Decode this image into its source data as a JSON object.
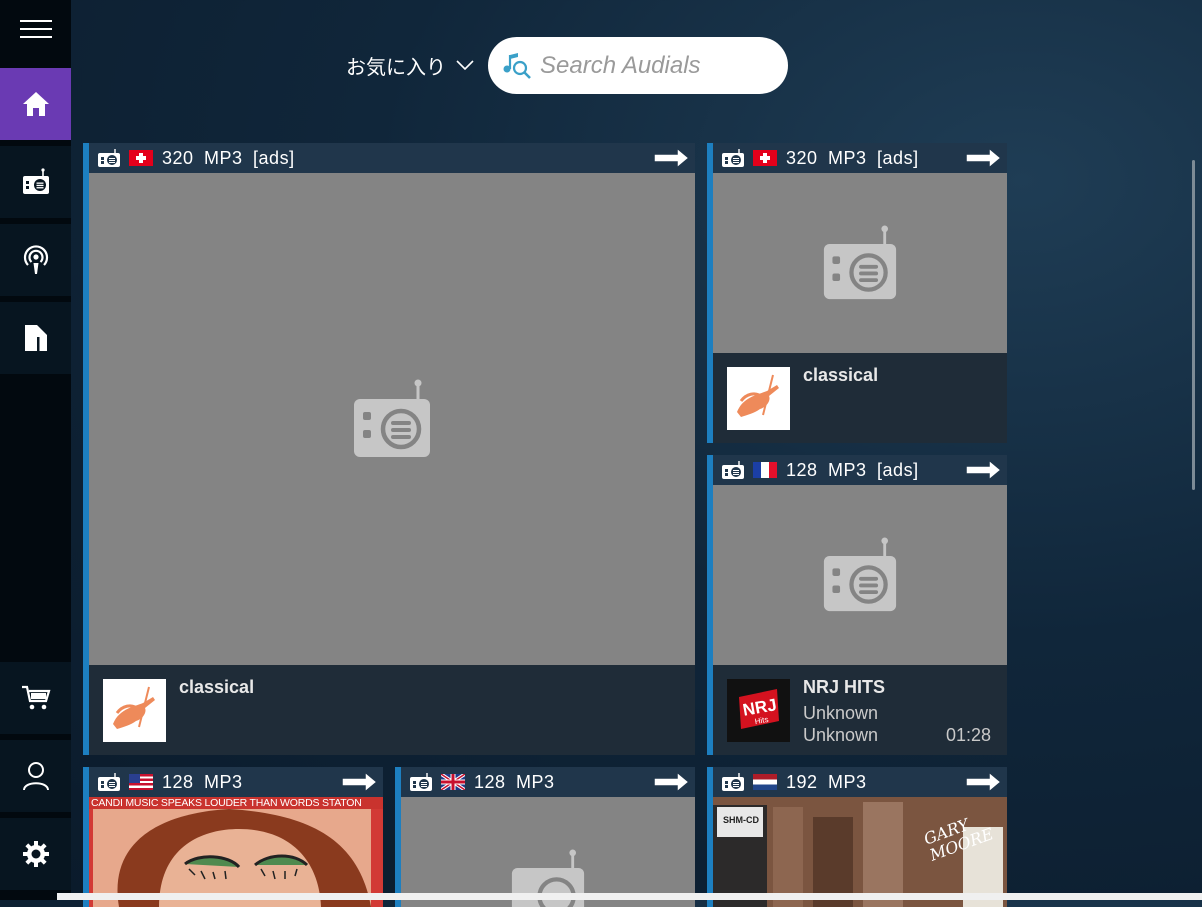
{
  "nav": {
    "items": [
      {
        "name": "menu",
        "icon": "hamburger-icon"
      },
      {
        "name": "home",
        "icon": "home-icon",
        "active": true
      },
      {
        "name": "radio",
        "icon": "radio-icon"
      },
      {
        "name": "podcast",
        "icon": "podcast-icon"
      },
      {
        "name": "library",
        "icon": "library-icon"
      },
      {
        "name": "shop",
        "icon": "cart-icon"
      },
      {
        "name": "account",
        "icon": "user-icon"
      },
      {
        "name": "settings",
        "icon": "gear-icon"
      }
    ]
  },
  "header": {
    "filter_label": "お気に入り",
    "search_placeholder": "Search Audials"
  },
  "tiles": {
    "big": {
      "info": "320  MP3  [ads]",
      "flag": "CH",
      "title": "classical"
    },
    "top_right": {
      "info": "320  MP3  [ads]",
      "flag": "CH",
      "title": "classical"
    },
    "nrj": {
      "info": "128  MP3  [ads]",
      "flag": "FR",
      "title": "NRJ HITS",
      "artist": "Unknown",
      "song": "Unknown",
      "time": "01:28"
    },
    "us": {
      "info": "128  MP3",
      "flag": "US",
      "art_text": "CANDI MUSIC SPEAKS LOUDER THAN WORDS STATON"
    },
    "uk": {
      "info": "128  MP3",
      "flag": "GB"
    },
    "nl": {
      "info": "192  MP3",
      "flag": "NL",
      "art_text": "GARY MOORE",
      "art_badge": "SHM-CD"
    }
  },
  "colors": {
    "accent": "#6a3ab3",
    "tile_border": "#1d7fc0"
  }
}
